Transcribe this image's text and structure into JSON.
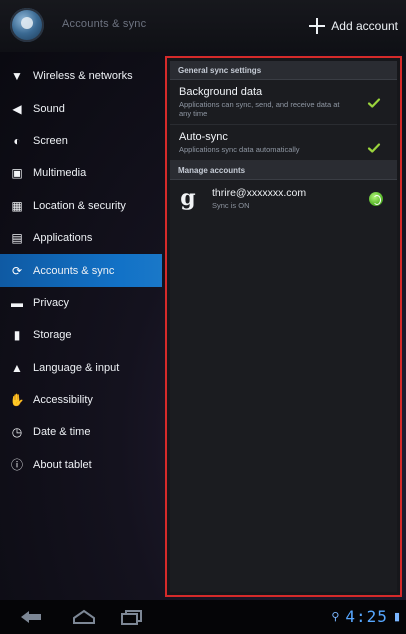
{
  "action_bar": {
    "title": "Accounts & sync",
    "add_account_label": "Add account"
  },
  "sidebar": {
    "items": [
      {
        "label": "Wireless & networks",
        "icon": "wifi-icon"
      },
      {
        "label": "Sound",
        "icon": "speaker-icon"
      },
      {
        "label": "Screen",
        "icon": "brightness-icon"
      },
      {
        "label": "Multimedia",
        "icon": "film-icon"
      },
      {
        "label": "Location & security",
        "icon": "grid-icon"
      },
      {
        "label": "Applications",
        "icon": "apps-icon"
      },
      {
        "label": "Accounts & sync",
        "icon": "sync-icon",
        "active": true
      },
      {
        "label": "Privacy",
        "icon": "privacy-icon"
      },
      {
        "label": "Storage",
        "icon": "storage-icon"
      },
      {
        "label": "Language & input",
        "icon": "language-icon"
      },
      {
        "label": "Accessibility",
        "icon": "accessibility-icon"
      },
      {
        "label": "Date & time",
        "icon": "clock-icon"
      },
      {
        "label": "About tablet",
        "icon": "info-icon"
      }
    ]
  },
  "panel": {
    "general_header": "General sync settings",
    "background_data": {
      "title": "Background data",
      "summary": "Applications can sync, send, and receive data at any time",
      "checked": true
    },
    "auto_sync": {
      "title": "Auto-sync",
      "summary": "Applications sync data automatically",
      "checked": true
    },
    "manage_header": "Manage accounts",
    "account": {
      "icon_glyph": "g",
      "email": "thrire@xxxxxxx.com",
      "status": "Sync is ON"
    }
  },
  "nav_bar": {
    "time": "4:25"
  },
  "colors": {
    "accent_blue": "#1272c7",
    "check_green": "#9ad43c",
    "highlight_red": "#d52a2a",
    "clock_blue": "#57a7ff"
  }
}
